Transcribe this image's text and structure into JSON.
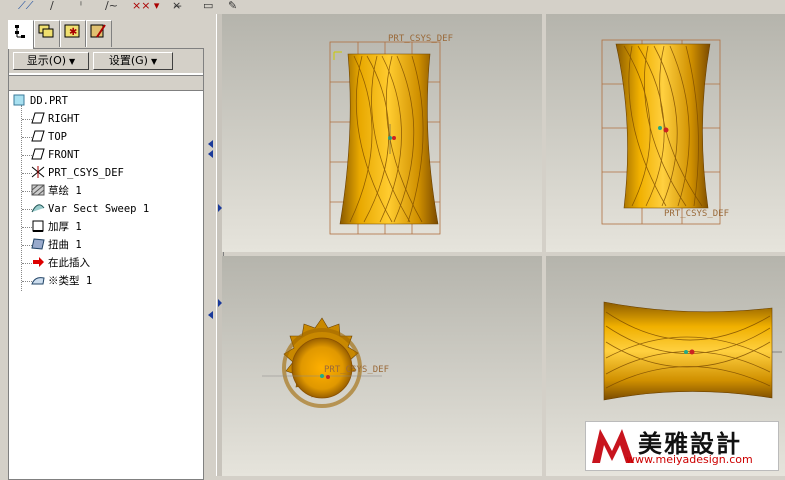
{
  "toolbar": {
    "icons": [
      "datum-plane-icon",
      "datum-axis-icon",
      "datum-curve-icon",
      "datum-point-icon",
      "csys-icon",
      "analysis-icon",
      "pen-icon"
    ]
  },
  "panel": {
    "tabs": [
      "model-tree-tab",
      "layer-tab",
      "favorites-tab",
      "settings-tab"
    ],
    "show_label": "显示(O)",
    "settings_label": "设置(G)"
  },
  "tree": {
    "root": "DD.PRT",
    "items": [
      {
        "label": "RIGHT",
        "icon": "datum-plane-icon"
      },
      {
        "label": "TOP",
        "icon": "datum-plane-icon"
      },
      {
        "label": "FRONT",
        "icon": "datum-plane-icon"
      },
      {
        "label": "PRT_CSYS_DEF",
        "icon": "csys-icon"
      },
      {
        "label": "草绘 1",
        "icon": "sketch-icon"
      },
      {
        "label": "Var Sect Sweep 1",
        "icon": "sweep-icon"
      },
      {
        "label": "加厚 1",
        "icon": "thicken-icon"
      },
      {
        "label": "扭曲 1",
        "icon": "warp-icon"
      },
      {
        "label": "在此插入",
        "icon": "insert-here-arrow-icon"
      },
      {
        "label": "※类型 1",
        "icon": "style-icon"
      }
    ]
  },
  "viewports": {
    "csys_label": "PRT_CSYS_DEF"
  },
  "watermark": {
    "brand": "美雅設計",
    "url": "www.meiyadesign.com"
  },
  "colors": {
    "part": "#d99a00",
    "part_dark": "#8a5a00",
    "part_light": "#ffd24a",
    "bbox": "#b07040"
  }
}
